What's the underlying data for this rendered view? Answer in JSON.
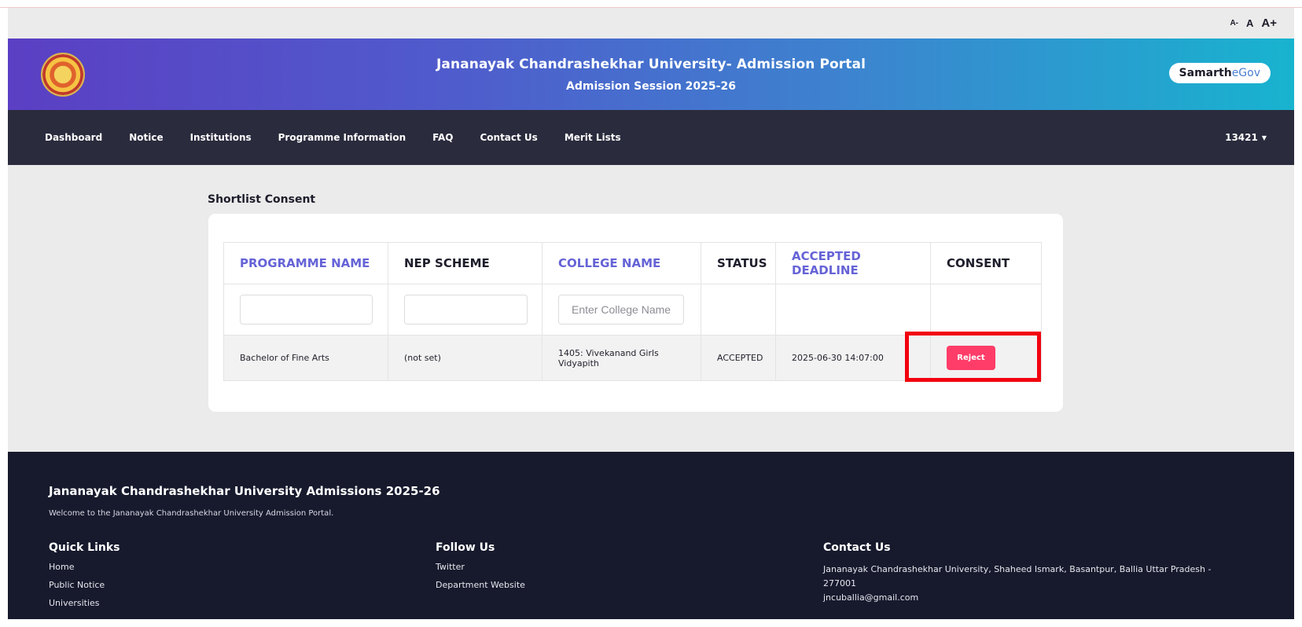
{
  "font_controls": {
    "small": "A-",
    "normal": "A",
    "large": "A+"
  },
  "header": {
    "title": "Jananayak Chandrashekhar University- Admission Portal",
    "subtitle": "Admission Session 2025-26",
    "brand_part1": "Samarth",
    "brand_part2": "eGov"
  },
  "nav": {
    "items": [
      "Dashboard",
      "Notice",
      "Institutions",
      "Programme Information",
      "FAQ",
      "Contact Us",
      "Merit Lists"
    ],
    "user": "13421"
  },
  "page": {
    "title": "Shortlist Consent"
  },
  "table": {
    "headers": [
      "PROGRAMME NAME",
      "NEP SCHEME",
      "COLLEGE NAME",
      "STATUS",
      "ACCEPTED DEADLINE",
      "CONSENT"
    ],
    "filters": {
      "programme": "",
      "nep": "",
      "college_placeholder": "Enter College Name"
    },
    "rows": [
      {
        "programme": "Bachelor of Fine Arts",
        "nep_scheme": "(not set)",
        "college": "1405: Vivekanand Girls Vidyapith",
        "status": "ACCEPTED",
        "deadline": "2025-06-30 14:07:00",
        "action": "Reject"
      }
    ]
  },
  "footer": {
    "title": "Jananayak Chandrashekhar University Admissions 2025-26",
    "welcome": "Welcome to the Jananayak Chandrashekhar University Admission Portal.",
    "quick_links": {
      "heading": "Quick Links",
      "items": [
        "Home",
        "Public Notice",
        "Universities"
      ]
    },
    "follow": {
      "heading": "Follow Us",
      "items": [
        "Twitter",
        "Department Website"
      ]
    },
    "contact": {
      "heading": "Contact Us",
      "address_line1": "Jananayak Chandrashekhar University, Shaheed Ismark, Basantpur, Ballia  Uttar Pradesh -",
      "address_line2": "277001",
      "email": "jncuballia@gmail.com"
    }
  },
  "colors": {
    "accent_header_text": "#6563d6",
    "reject_button": "#ff3d68",
    "highlight": "#f2000f",
    "nav_bg": "#2a2b3d",
    "footer_bg": "#171a2d"
  }
}
